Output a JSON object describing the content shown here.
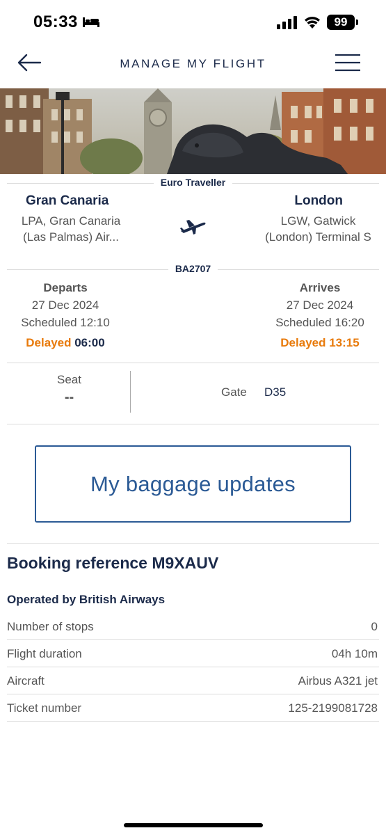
{
  "status_bar": {
    "time": "05:33",
    "battery": "99",
    "icons": [
      "bed-icon",
      "signal-icon",
      "wifi-icon",
      "battery-icon"
    ]
  },
  "header": {
    "title": "MANAGE MY FLIGHT",
    "back_icon": "arrow-left-icon",
    "menu_icon": "hamburger-menu-icon"
  },
  "hero": {
    "image": "london-lion-statue-photo"
  },
  "flight": {
    "cabin": "Euro Traveller",
    "origin": {
      "city": "Gran Canaria",
      "airport": "LPA, Gran Canaria (Las Palmas) Air..."
    },
    "destination": {
      "city": "London",
      "airport": "LGW, Gatwick (London) Terminal S"
    },
    "number": "BA2707",
    "departs": {
      "label": "Departs",
      "date": "27 Dec 2024",
      "scheduled": "Scheduled 12:10",
      "delayed_label": "Delayed",
      "delayed_time": "06:00"
    },
    "arrives": {
      "label": "Arrives",
      "date": "27 Dec 2024",
      "scheduled": "Scheduled 16:20",
      "delayed_label": "Delayed",
      "delayed_time": "13:15"
    }
  },
  "seat": {
    "label": "Seat",
    "value": "--"
  },
  "gate": {
    "label": "Gate",
    "value": "D35"
  },
  "baggage_button": "My baggage updates",
  "booking": {
    "reference": "Booking reference M9XAUV",
    "operated_by": "Operated by British Airways",
    "details": [
      {
        "key": "Number of stops",
        "value": "0"
      },
      {
        "key": "Flight duration",
        "value": "04h 10m"
      },
      {
        "key": "Aircraft",
        "value": "Airbus A321 jet"
      },
      {
        "key": "Ticket number",
        "value": "125-2199081728"
      }
    ]
  },
  "colors": {
    "navy": "#1b2a4a",
    "accent_blue": "#2b5a95",
    "delay_orange": "#e87a0b"
  }
}
